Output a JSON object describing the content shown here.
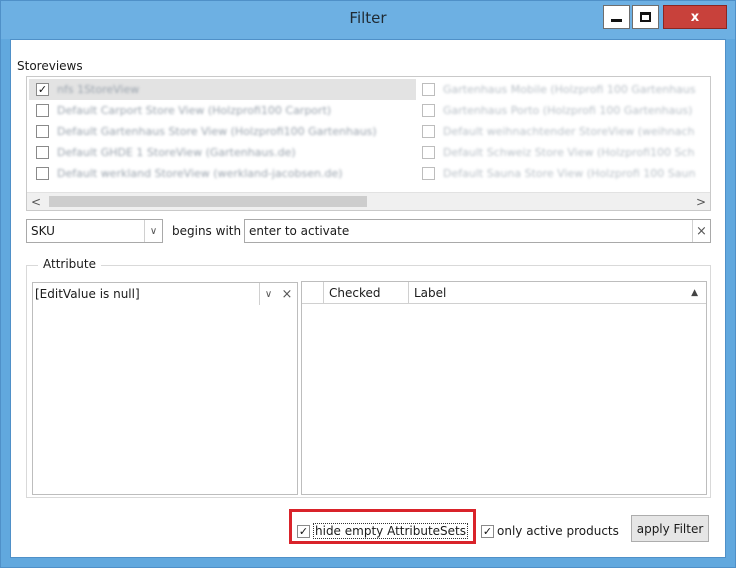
{
  "window": {
    "title": "Filter",
    "minimize_icon": "minimize-icon",
    "maximize_icon": "maximize-icon",
    "close_icon": "close-icon",
    "close_glyph": "x",
    "close_color": "#c8413b",
    "titlebar_color": "#6db0e3"
  },
  "storeviews": {
    "label": "Storeviews",
    "left_column": [
      {
        "label": "nfs 1StoreView",
        "checked": true,
        "selected": true
      },
      {
        "label": "Default Carport Store View (Holzprofi100 Carport)",
        "checked": false
      },
      {
        "label": "Default Gartenhaus Store View (Holzprofi100 Gartenhaus)",
        "checked": false
      },
      {
        "label": "Default GHDE 1 StoreView (Gartenhaus.de)",
        "checked": false
      },
      {
        "label": "Default werkland StoreView (werkland-jacobsen.de)",
        "checked": false
      }
    ],
    "right_column": [
      {
        "label": "Gartenhaus Mobile (Holzprofi 100 Gartenhaus",
        "checked": false
      },
      {
        "label": "Gartenhaus Porto (Holzprofi 100 Gartenhaus)",
        "checked": false
      },
      {
        "label": "Default weihnachtender StoreView (weihnach",
        "checked": false
      },
      {
        "label": "Default Schweiz Store View (Holzprofi100 Sch",
        "checked": false
      },
      {
        "label": "Default Sauna Store View (Holzprofi 100 Saun",
        "checked": false
      }
    ],
    "scroll_left_glyph": "<",
    "scroll_right_glyph": ">"
  },
  "filter": {
    "field": "SKU",
    "operator_label": "begins with",
    "value_placeholder": "enter to activate",
    "clear_glyph": "×"
  },
  "attribute": {
    "legend": "Attribute",
    "editvalue": "[EditValue is null]",
    "dropdown_glyph": "∨",
    "clear_glyph": "×",
    "grid_columns": [
      "Checked",
      "Label"
    ],
    "sort_glyph": "▲"
  },
  "bottom": {
    "hide_empty_label": "hide empty AttributeSets",
    "hide_empty_checked": true,
    "only_active_label": "only active products",
    "only_active_checked": true,
    "apply_label": "apply Filter"
  },
  "check_glyph": "✓"
}
